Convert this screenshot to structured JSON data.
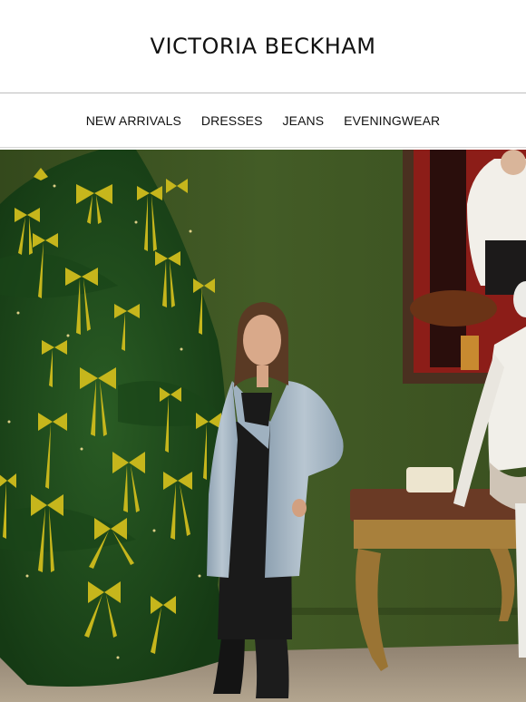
{
  "brand": {
    "name": "VICTORIA BECKHAM"
  },
  "nav": {
    "items": [
      {
        "label": "NEW ARRIVALS"
      },
      {
        "label": "DRESSES"
      },
      {
        "label": "JEANS"
      },
      {
        "label": "EVENINGWEAR"
      }
    ]
  },
  "hero": {
    "image": "photo-of-woman-beside-christmas-tree-with-yellow-bows-and-mannequin",
    "colors": {
      "wall": "#3d5522",
      "tree": "#1f4a1c",
      "bows": "#c8b820",
      "floor": "#a89880"
    }
  }
}
